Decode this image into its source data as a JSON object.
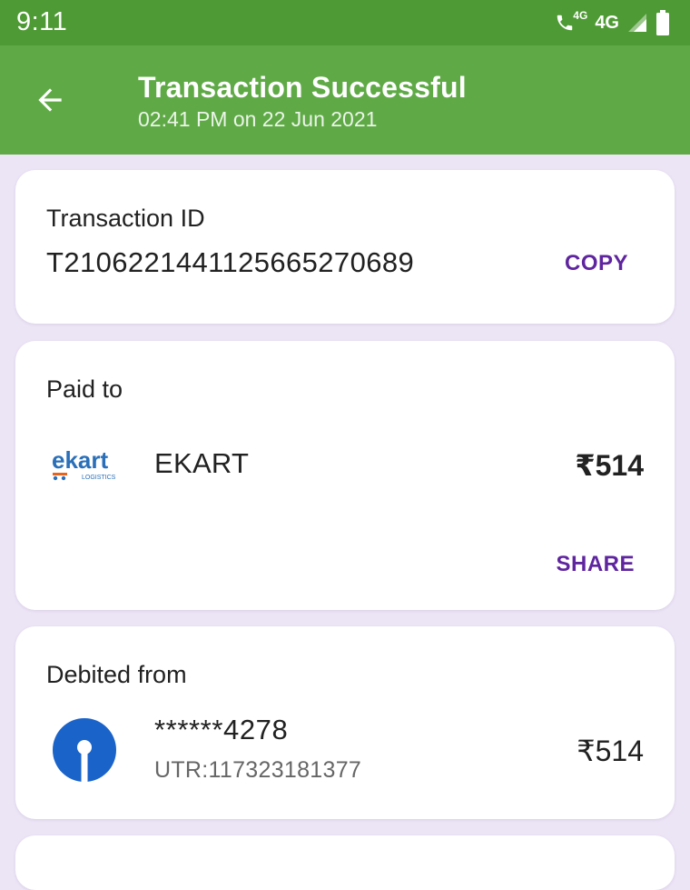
{
  "status_bar": {
    "time": "9:11",
    "tiny_network": "4G",
    "network": "4G"
  },
  "header": {
    "title": "Transaction Successful",
    "subtitle": "02:41 PM on 22 Jun 2021"
  },
  "transaction_card": {
    "heading": "Transaction ID",
    "id": "T2106221441125665270689",
    "copy_label": "COPY"
  },
  "paid_to_card": {
    "heading": "Paid to",
    "merchant_logo_text": "ekart",
    "merchant_logo_subtext": "LOGISTICS",
    "merchant_name": "EKART",
    "amount": "₹514",
    "share_label": "SHARE"
  },
  "debited_card": {
    "heading": "Debited from",
    "account": "******4278",
    "utr": "UTR:117323181377",
    "amount": "₹514"
  },
  "colors": {
    "status_bar": "#4e9a34",
    "app_bar": "#5faa46",
    "accent": "#5f259f",
    "background": "#ece5f6",
    "bank_logo": "#1a63c9",
    "ekart_logo": "#2a6fb8"
  }
}
